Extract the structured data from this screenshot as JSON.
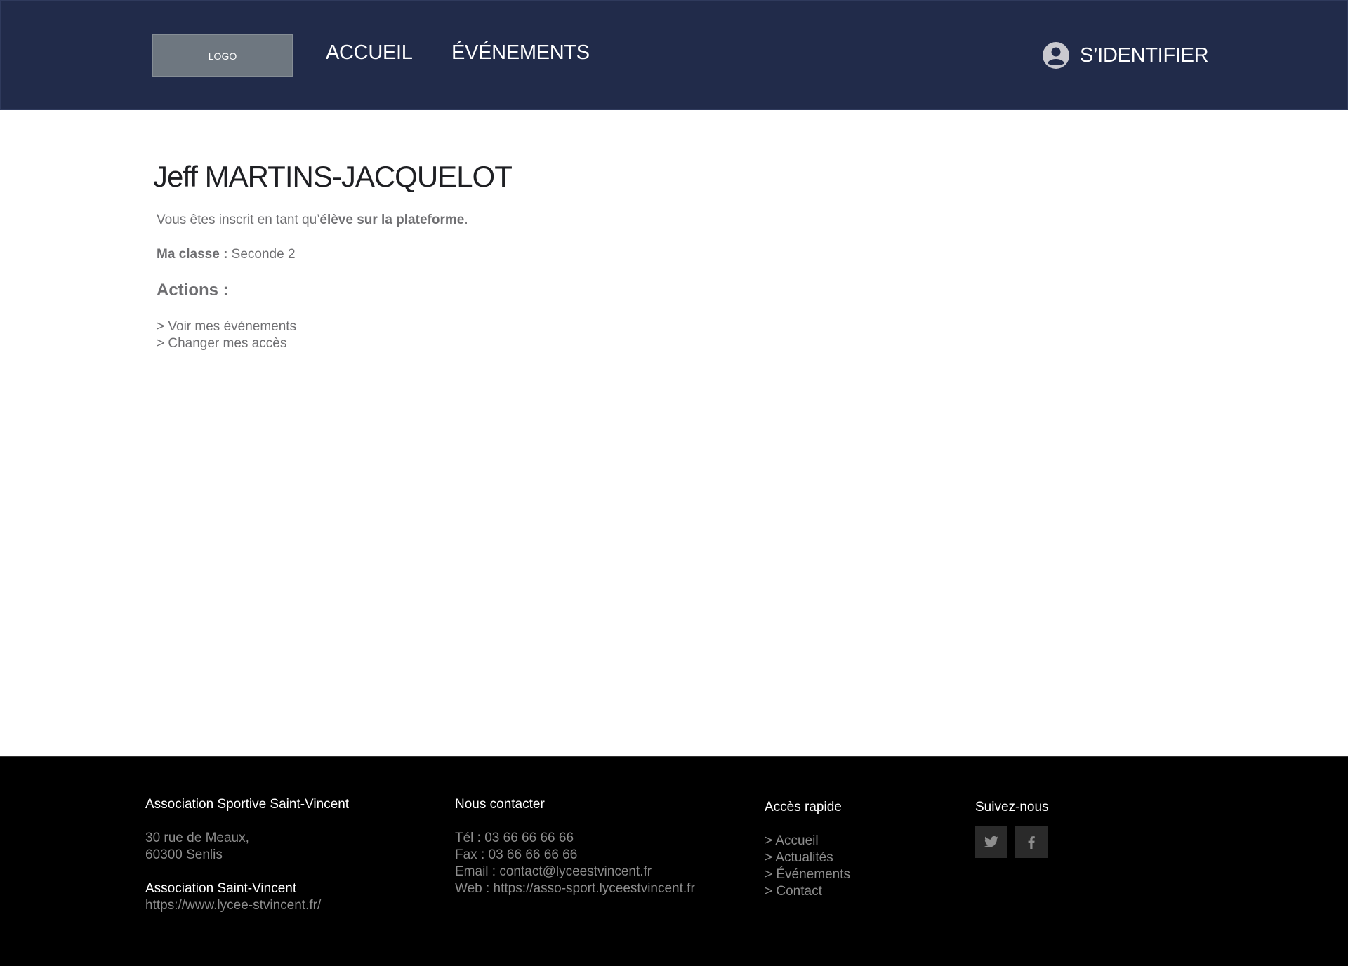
{
  "header": {
    "logo_text": "LOGO",
    "nav": [
      {
        "label": "ACCUEIL"
      },
      {
        "label": "ÉVÉNEMENTS"
      }
    ],
    "login_label": "S’IDENTIFIER",
    "login_icon": "user-circle-icon"
  },
  "profile": {
    "name": "Jeff MARTINS-JACQUELOT",
    "status_prefix": "Vous êtes inscrit en tant qu’",
    "status_role": "élève sur la plateforme",
    "status_suffix": ".",
    "class_label": "Ma classe :",
    "class_value": " Seconde 2",
    "actions_title": "Actions :",
    "actions": [
      {
        "label": "> Voir mes événements"
      },
      {
        "label": "> Changer mes accès"
      }
    ]
  },
  "footer": {
    "association": {
      "title": "Association Sportive Saint-Vincent",
      "address_line1": "30 rue de Meaux,",
      "address_line2": "60300 Senlis",
      "parent_title": "Association Saint-Vincent",
      "parent_url": "https://www.lycee-stvincent.fr/"
    },
    "contact": {
      "title": "Nous contacter",
      "tel": "Tél : 03 66 66 66 66",
      "fax": "Fax : 03 66 66 66 66",
      "email": "Email : contact@lyceestvincent.fr",
      "web": "Web : https://asso-sport.lyceestvincent.fr"
    },
    "quick_access": {
      "title": "Accès rapide",
      "links": [
        {
          "label": "> Accueil"
        },
        {
          "label": "> Actualités"
        },
        {
          "label": "> Événements"
        },
        {
          "label": "> Contact"
        }
      ]
    },
    "follow": {
      "title": "Suivez-nous",
      "icons": [
        "twitter-icon",
        "facebook-icon"
      ]
    }
  }
}
